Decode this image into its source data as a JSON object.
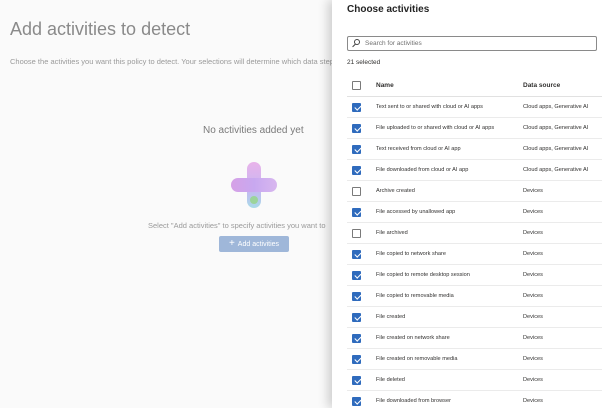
{
  "background": {
    "title": "Add activities to detect",
    "description": "Choose the activities you want this policy to detect. Your selections will determine which data step.",
    "empty_title": "No activities added yet",
    "hint": "Select \"Add activities\" to specify activities you want to",
    "add_button_label": "Add activities",
    "add_button_icon": "plus-icon"
  },
  "panel": {
    "title": "Choose activities",
    "search": {
      "placeholder": "Search for activities",
      "value": ""
    },
    "selected_count": "21 selected",
    "columns": {
      "name": "Name",
      "source": "Data source"
    },
    "rows": [
      {
        "name": "Text sent to or shared with cloud or AI apps",
        "source": "Cloud apps, Generative AI",
        "checked": true
      },
      {
        "name": "File uploaded to or shared with cloud or AI apps",
        "source": "Cloud apps, Generative AI",
        "checked": true
      },
      {
        "name": "Text received from cloud or AI app",
        "source": "Cloud apps, Generative AI",
        "checked": true
      },
      {
        "name": "File downloaded from cloud or AI app",
        "source": "Cloud apps, Generative AI",
        "checked": true
      },
      {
        "name": "Archive created",
        "source": "Devices",
        "checked": false
      },
      {
        "name": "File accessed by unallowed app",
        "source": "Devices",
        "checked": true
      },
      {
        "name": "File archived",
        "source": "Devices",
        "checked": false
      },
      {
        "name": "File copied to network share",
        "source": "Devices",
        "checked": true
      },
      {
        "name": "File copied to remote desktop session",
        "source": "Devices",
        "checked": true
      },
      {
        "name": "File copied to removable media",
        "source": "Devices",
        "checked": true
      },
      {
        "name": "File created",
        "source": "Devices",
        "checked": true
      },
      {
        "name": "File created on network share",
        "source": "Devices",
        "checked": true
      },
      {
        "name": "File created on removable media",
        "source": "Devices",
        "checked": true
      },
      {
        "name": "File deleted",
        "source": "Devices",
        "checked": true
      },
      {
        "name": "File downloaded from browser",
        "source": "Devices",
        "checked": true
      }
    ]
  },
  "colors": {
    "accent": "#2f6bbd",
    "button_dimmed": "#9fb7d9"
  }
}
